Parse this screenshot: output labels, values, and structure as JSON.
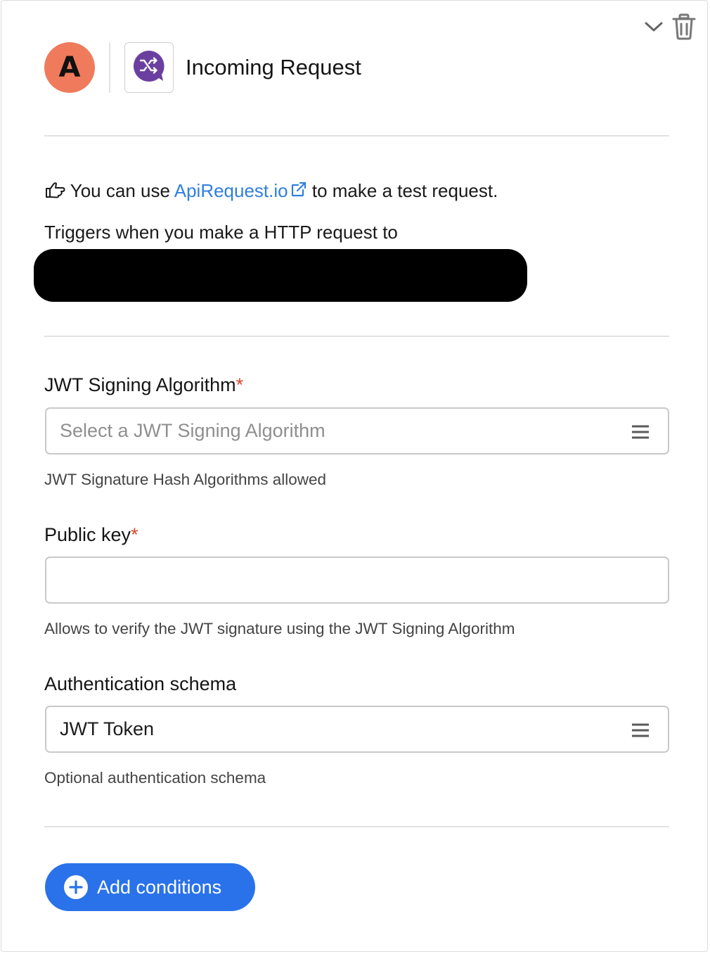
{
  "header": {
    "avatar_letter": "A",
    "title": "Incoming Request",
    "app_icon": "shuffle-chat-icon"
  },
  "top_actions": {
    "collapse_icon": "chevron-down-icon",
    "delete_icon": "trash-icon"
  },
  "info": {
    "hand_icon": "pointing-hand-icon",
    "prefix": "You can use",
    "link_text": "ApiRequest.io",
    "link_icon": "external-link-icon",
    "suffix": "to make a test request.",
    "trigger_text": "Triggers when you make a HTTP request to"
  },
  "fields": {
    "jwt_algorithm": {
      "label": "JWT Signing Algorithm",
      "required_mark": "*",
      "placeholder": "Select a JWT Signing Algorithm",
      "help": "JWT Signature Hash Algorithms allowed"
    },
    "public_key": {
      "label": "Public key",
      "required_mark": "*",
      "value": "",
      "help": "Allows to verify the JWT signature using the JWT Signing Algorithm"
    },
    "auth_schema": {
      "label": "Authentication schema",
      "value": "JWT Token",
      "help": "Optional authentication schema"
    }
  },
  "add_conditions": {
    "label": "Add conditions",
    "icon": "plus-circle-icon"
  },
  "colors": {
    "avatar": "#ef7b5c",
    "app_icon": "#6b3fa0",
    "link": "#2f7fe0",
    "required": "#d8482a",
    "primary_button": "#2a72ea"
  }
}
